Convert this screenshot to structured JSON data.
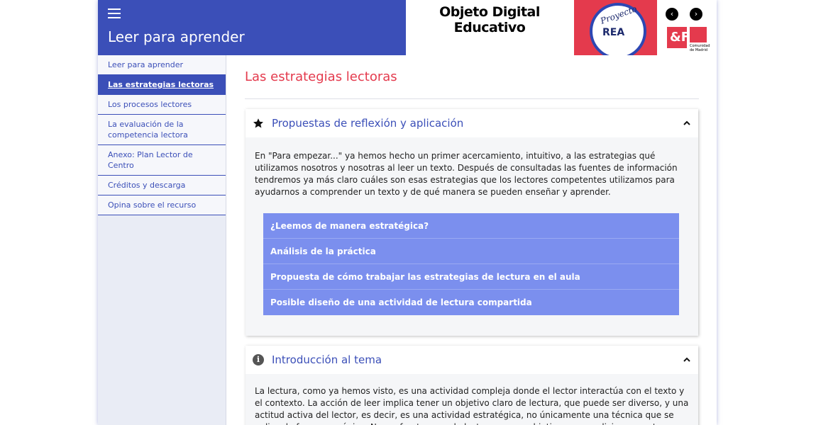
{
  "header": {
    "site_title": "Leer para aprender",
    "oda_title": "Objeto Digital Educativo",
    "logo_text_top": "Proyecto",
    "logo_text_main": "REA",
    "prev_label": "‹",
    "next_label": "›",
    "brand_a": "&F",
    "brand_b_text": "Comunidad de Madrid"
  },
  "sidebar": {
    "items": [
      {
        "label": "Leer para aprender",
        "active": false
      },
      {
        "label": "Las estrategias lectoras",
        "active": true
      },
      {
        "label": "Los procesos lectores",
        "active": false
      },
      {
        "label": "La evaluación de la competencia lectora",
        "active": false
      },
      {
        "label": "Anexo: Plan Lector de Centro",
        "active": false
      },
      {
        "label": "Créditos y descarga",
        "active": false
      },
      {
        "label": "Opina sobre el recurso",
        "active": false
      }
    ]
  },
  "main": {
    "page_title": "Las estrategias lectoras",
    "panel1": {
      "title": "Propuestas de reflexión y aplicación",
      "icon": "star-icon",
      "text": "En \"Para empezar...\" ya hemos hecho un primer acercamiento, intuitivo, a las estrategias qué utilizamos nosotros y nosotras al leer un texto. Después de consultadas las fuentes de información tendremos ya más claro cuáles son esas estrategias que los lectores competentes utilizamos para ayudarnos a comprender un texto y de qué manera se pueden enseñar y aprender.",
      "accordion": [
        "¿Leemos de manera estratégica?",
        "Análisis de la práctica",
        "Propuesta de cómo trabajar las estrategias de lectura en el aula",
        "Posible diseño de una actividad de lectura compartida"
      ]
    },
    "panel2": {
      "title": "Introducción al tema",
      "icon": "info-icon",
      "info_glyph": "i",
      "text": "La lectura, como ya hemos visto, es una actividad compleja donde el lector interactúa con el texto y el contexto. La acción de leer implica tener un objetivo claro de lectura, que puede ser diverso, y una actitud activa del lector, es decir, es una actividad estratégica, no únicamente una técnica que se aplica de forma mecánica. Nos enfrentamos a la lectura con un objetivo que condiciona nuestra forma de leer."
    }
  },
  "colors": {
    "header_blue": "#3b4fb8",
    "accent_red": "#e43a4d",
    "accordion_blue": "#7b8fee"
  }
}
